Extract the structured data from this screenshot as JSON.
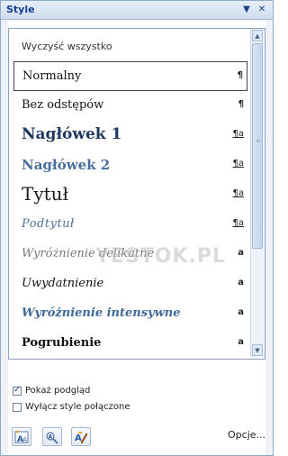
{
  "pane": {
    "title": "Style",
    "dropdown_glyph": "▼",
    "close_glyph": "✕"
  },
  "list": {
    "clear_all": "Wyczyść wszystko",
    "watermark": "YESTOK.PL",
    "items": [
      {
        "label": "Normalny",
        "glyph": "¶",
        "selected": true
      },
      {
        "label": "Bez odstępów",
        "glyph": "¶"
      },
      {
        "label": "Nagłówek 1",
        "glyph": "¶a"
      },
      {
        "label": "Nagłówek 2",
        "glyph": "¶a"
      },
      {
        "label": "Tytuł",
        "glyph": "¶a"
      },
      {
        "label": "Podtytuł",
        "glyph": "¶a"
      },
      {
        "label": "Wyróżnienie delikatne",
        "glyph": "a"
      },
      {
        "label": "Uwydatnienie",
        "glyph": "a"
      },
      {
        "label": "Wyróżnienie intensywne",
        "glyph": "a"
      },
      {
        "label": "Pogrubienie",
        "glyph": "a"
      }
    ]
  },
  "options": {
    "show_preview": "Pokaż podgląd",
    "show_preview_checked": true,
    "disable_linked": "Wyłącz style połączone",
    "disable_linked_checked": false
  },
  "footer": {
    "options_link": "Opcje..."
  },
  "icons": {
    "new_style": "new-style-icon",
    "style_inspector": "style-inspector-icon",
    "manage_styles": "manage-styles-icon"
  }
}
